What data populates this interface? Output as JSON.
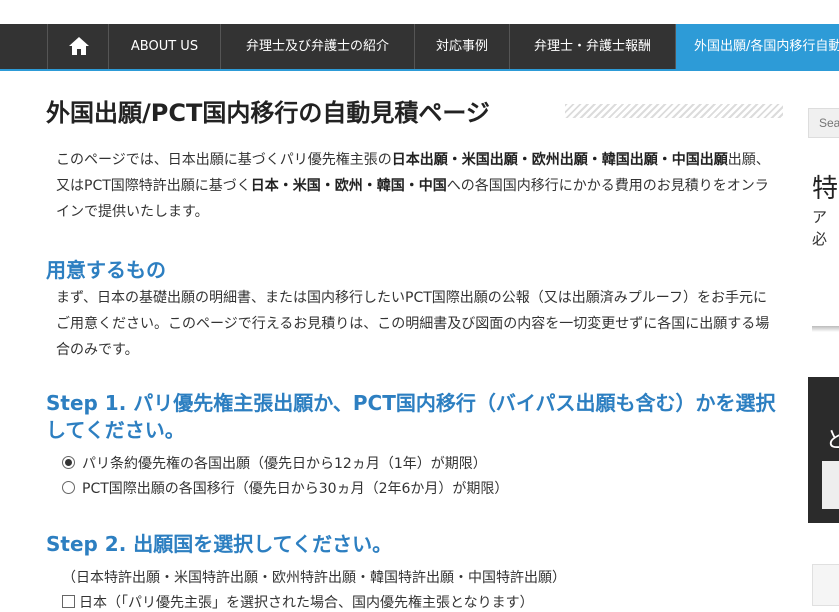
{
  "nav": {
    "items": [
      {
        "label": "ABOUT US"
      },
      {
        "label": "弁理士及び弁護士の紹介"
      },
      {
        "label": "対応事例"
      },
      {
        "label": "弁理士・弁護士報酬"
      },
      {
        "label": "外国出願/各国内移行自動見積"
      }
    ]
  },
  "page": {
    "title": "外国出願/PCT国内移行の自動見積ページ",
    "intro": {
      "p1": "このページでは、日本出願に基づくパリ優先権主張の",
      "b1": "日本出願・米国出願・欧州出願・韓国出願・中国出願",
      "p2": "出願、又はPCT国際特許出願に基づく",
      "b2": "日本・米国・欧州・韓国・中国",
      "p3": "への各国国内移行にかかる費用のお見積りをオンラインで提供いたします。"
    },
    "prep_heading": "用意するもの",
    "prep_text": "まず、日本の基礎出願の明細書、または国内移行したいPCT国際出願の公報（又は出願済みプルーフ）をお手元にご用意ください。このページで行えるお見積りは、この明細書及び図面の内容を一切変更せずに各国に出願する場合のみです。",
    "step1": {
      "heading": "Step 1. パリ優先権主張出願か、PCT国内移行（バイパス出願も含む）かを選択してください。",
      "options": [
        {
          "label": "パリ条約優先権の各国出願（優先日から12ヵ月（1年）が期限）",
          "checked": true
        },
        {
          "label": "PCT国際出願の各国移行（優先日から30ヵ月（2年6か月）が期限）",
          "checked": false
        }
      ]
    },
    "step2": {
      "heading": "Step 2. 出願国を選択してください。",
      "note": "（日本特許出願・米国特許出願・欧州特許出願・韓国特許出願・中国特許出願）",
      "first_option": "日本（「パリ優先主張」を選択された場合、国内優先権主張となります）"
    }
  },
  "sidebar": {
    "search_placeholder": "Sea",
    "widget_title": "特",
    "widget_line2": "ア",
    "widget_line3": "必",
    "dark_widget_text": "ど"
  },
  "colors": {
    "nav_bg": "#333333",
    "nav_active": "#2d9bd7",
    "heading_blue": "#2d7fc1"
  }
}
